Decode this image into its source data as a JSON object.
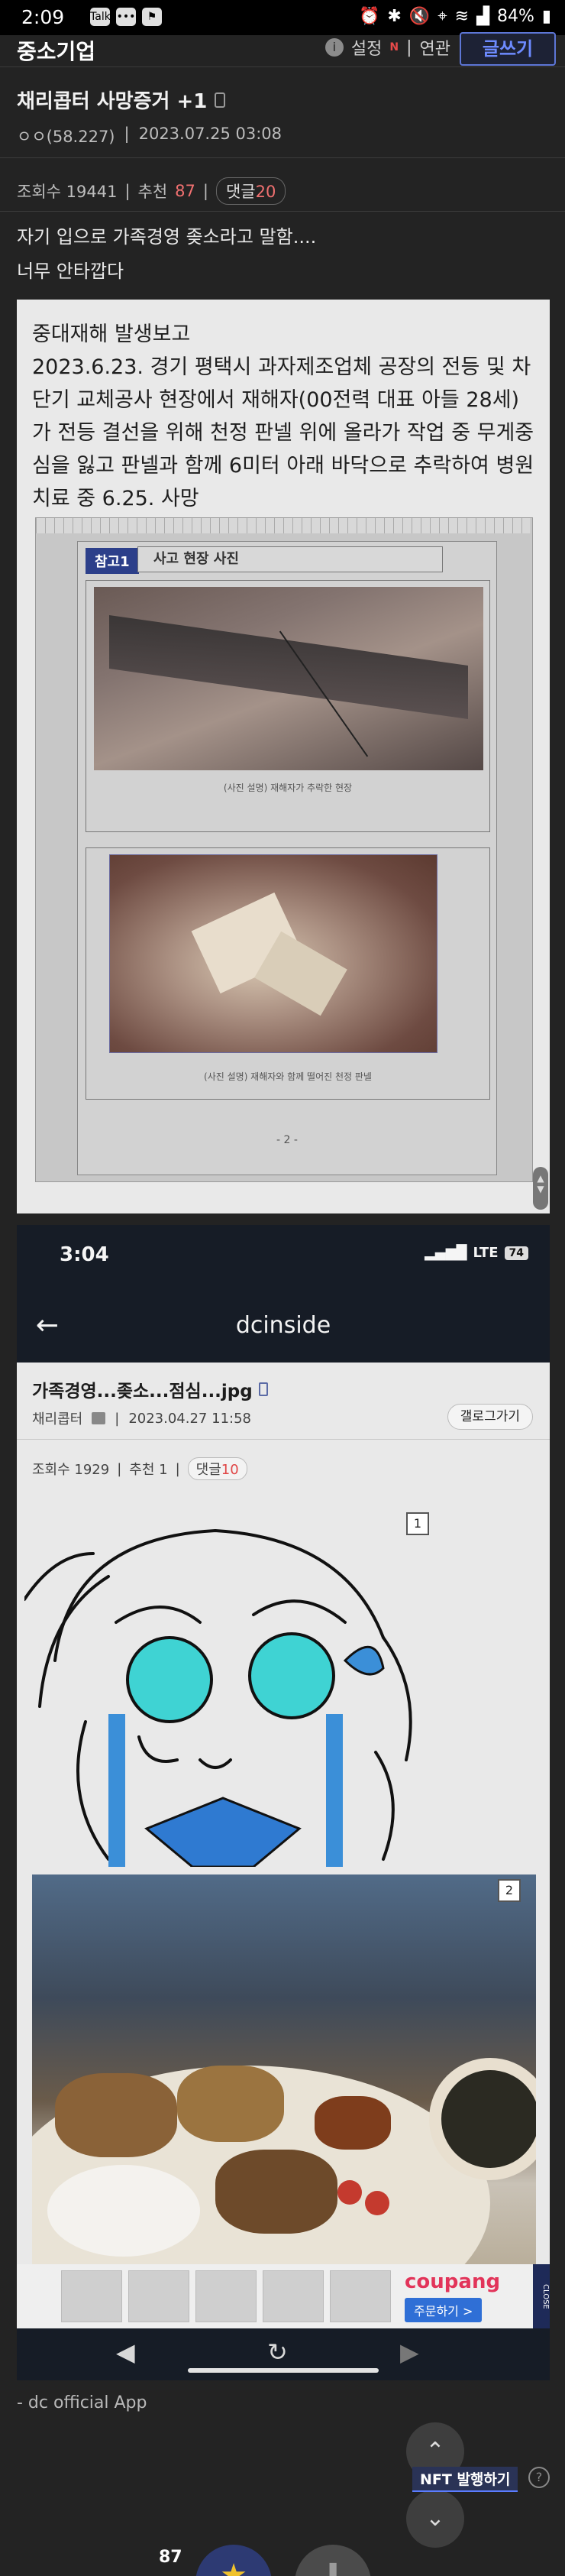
{
  "status_bar": {
    "time": "2:09",
    "battery": "84%",
    "notification_icons": [
      "talk-icon",
      "chat-icon",
      "flag-icon"
    ],
    "system_icons": [
      "alarm-icon",
      "bluetooth-icon",
      "mute-icon",
      "location-icon",
      "wifi-icon",
      "signal-icon"
    ]
  },
  "header": {
    "gallery_title": "중소기업",
    "settings_label": "설정",
    "new_badge": "N",
    "separator": "|",
    "related_label": "연관",
    "write_button": "글쓰기"
  },
  "post": {
    "title": "채리콥터 사망증거 +1",
    "author": "ㅇㅇ(58.227)",
    "date": "2023.07.25 03:08",
    "views_label": "조회수 19441",
    "recommend_label": "추천",
    "recommend_count": "87",
    "comment_label": "댓글",
    "comment_count": "20",
    "body_lines": [
      "자기 입으로 가족경영 좆소라고 말함....",
      "너무 안타깝다"
    ]
  },
  "image1": {
    "report_title": "중대재해 발생보고",
    "report_body": "2023.6.23. 경기 평택시 과자제조업체 공장의 전등 및 차단기 교체공사 현장에서 재해자(00전력 대표 아들 28세)가 전등 결선을 위해 천정 판넬 위에 올라가 작업 중 무게중심을 잃고 판넬과 함께 6미터 아래 바닥으로 추락하여 병원 치료 중 6.25. 사망",
    "ref_label": "참고1",
    "ref_title": "사고 현장 사진",
    "caption_a": "(사진 설명) 재해자가 추락한 현장",
    "caption_b": "(사진 설명) 재해자와 함께 떨어진 천정 판넬",
    "page_num": "- 2 -"
  },
  "image2": {
    "phone_time": "3:04",
    "network": "LTE",
    "battery": "74",
    "app_title": "dcinside",
    "post_title": "가족경영...좆소...점심...jpg",
    "author": "채리콥터",
    "date": "2023.04.27 11:58",
    "gallery_button": "갤로그가기",
    "views_label": "조회수 1929",
    "recommend_label": "추천 1",
    "comment_label": "댓글",
    "comment_count": "10",
    "image_tags": [
      "1",
      "2"
    ],
    "ad_brand": "coupang",
    "ad_cta": "주문하기 >",
    "ad_close": "CLOSE"
  },
  "footer": {
    "app_signature": "- dc official App",
    "nft_button": "NFT 발행하기",
    "help": "?",
    "recommend_count": "87"
  },
  "colors": {
    "background": "#232323",
    "accent": "#5d76d6",
    "highlight_red": "#f07070"
  }
}
